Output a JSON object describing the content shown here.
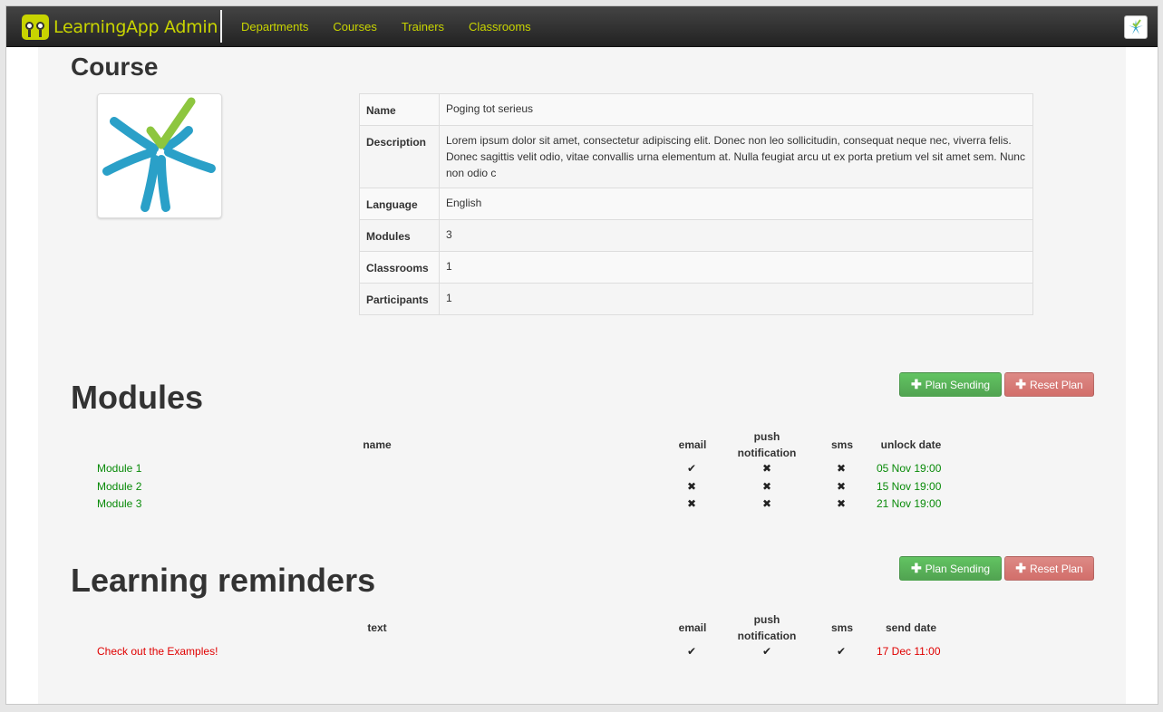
{
  "app": {
    "title": "LearningApp Admin"
  },
  "nav": {
    "items": [
      "Departments",
      "Courses",
      "Trainers",
      "Classrooms"
    ]
  },
  "course": {
    "title": "Course",
    "fields": [
      {
        "key": "Name",
        "value": "Poging tot serieus"
      },
      {
        "key": "Description",
        "value": "Lorem ipsum dolor sit amet, consectetur adipiscing elit. Donec non leo sollicitudin, consequat neque nec, viverra felis. Donec sagittis velit odio, vitae convallis urna elementum at. Nulla feugiat arcu ut ex porta pretium vel sit amet sem. Nunc non odio c"
      },
      {
        "key": "Language",
        "value": "English"
      },
      {
        "key": "Modules",
        "value": "3"
      },
      {
        "key": "Classrooms",
        "value": "1"
      },
      {
        "key": "Participants",
        "value": "1"
      }
    ]
  },
  "modules": {
    "title": "Modules",
    "plan_label": "Plan Sending",
    "reset_label": "Reset Plan",
    "headers": {
      "name": "name",
      "email": "email",
      "push": "push notification",
      "sms": "sms",
      "date": "unlock date"
    },
    "rows": [
      {
        "name": "Module 1",
        "email": "✔",
        "push": "✖",
        "sms": "✖",
        "date": "05 Nov 19:00"
      },
      {
        "name": "Module 2",
        "email": "✖",
        "push": "✖",
        "sms": "✖",
        "date": "15 Nov 19:00"
      },
      {
        "name": "Module 3",
        "email": "✖",
        "push": "✖",
        "sms": "✖",
        "date": "21 Nov 19:00"
      }
    ]
  },
  "reminders": {
    "title": "Learning reminders",
    "plan_label": "Plan Sending",
    "reset_label": "Reset Plan",
    "headers": {
      "text": "text",
      "email": "email",
      "push": "push notification",
      "sms": "sms",
      "date": "send date"
    },
    "rows": [
      {
        "text": "Check out the Examples!",
        "email": "✔",
        "push": "✔",
        "sms": "✔",
        "date": "17 Dec 11:00"
      }
    ]
  },
  "colors": {
    "brand": "#c8d400",
    "link_green": "#088a08",
    "link_red": "#e00000",
    "btn_green": "#51a351",
    "btn_red": "#d26e6a"
  }
}
